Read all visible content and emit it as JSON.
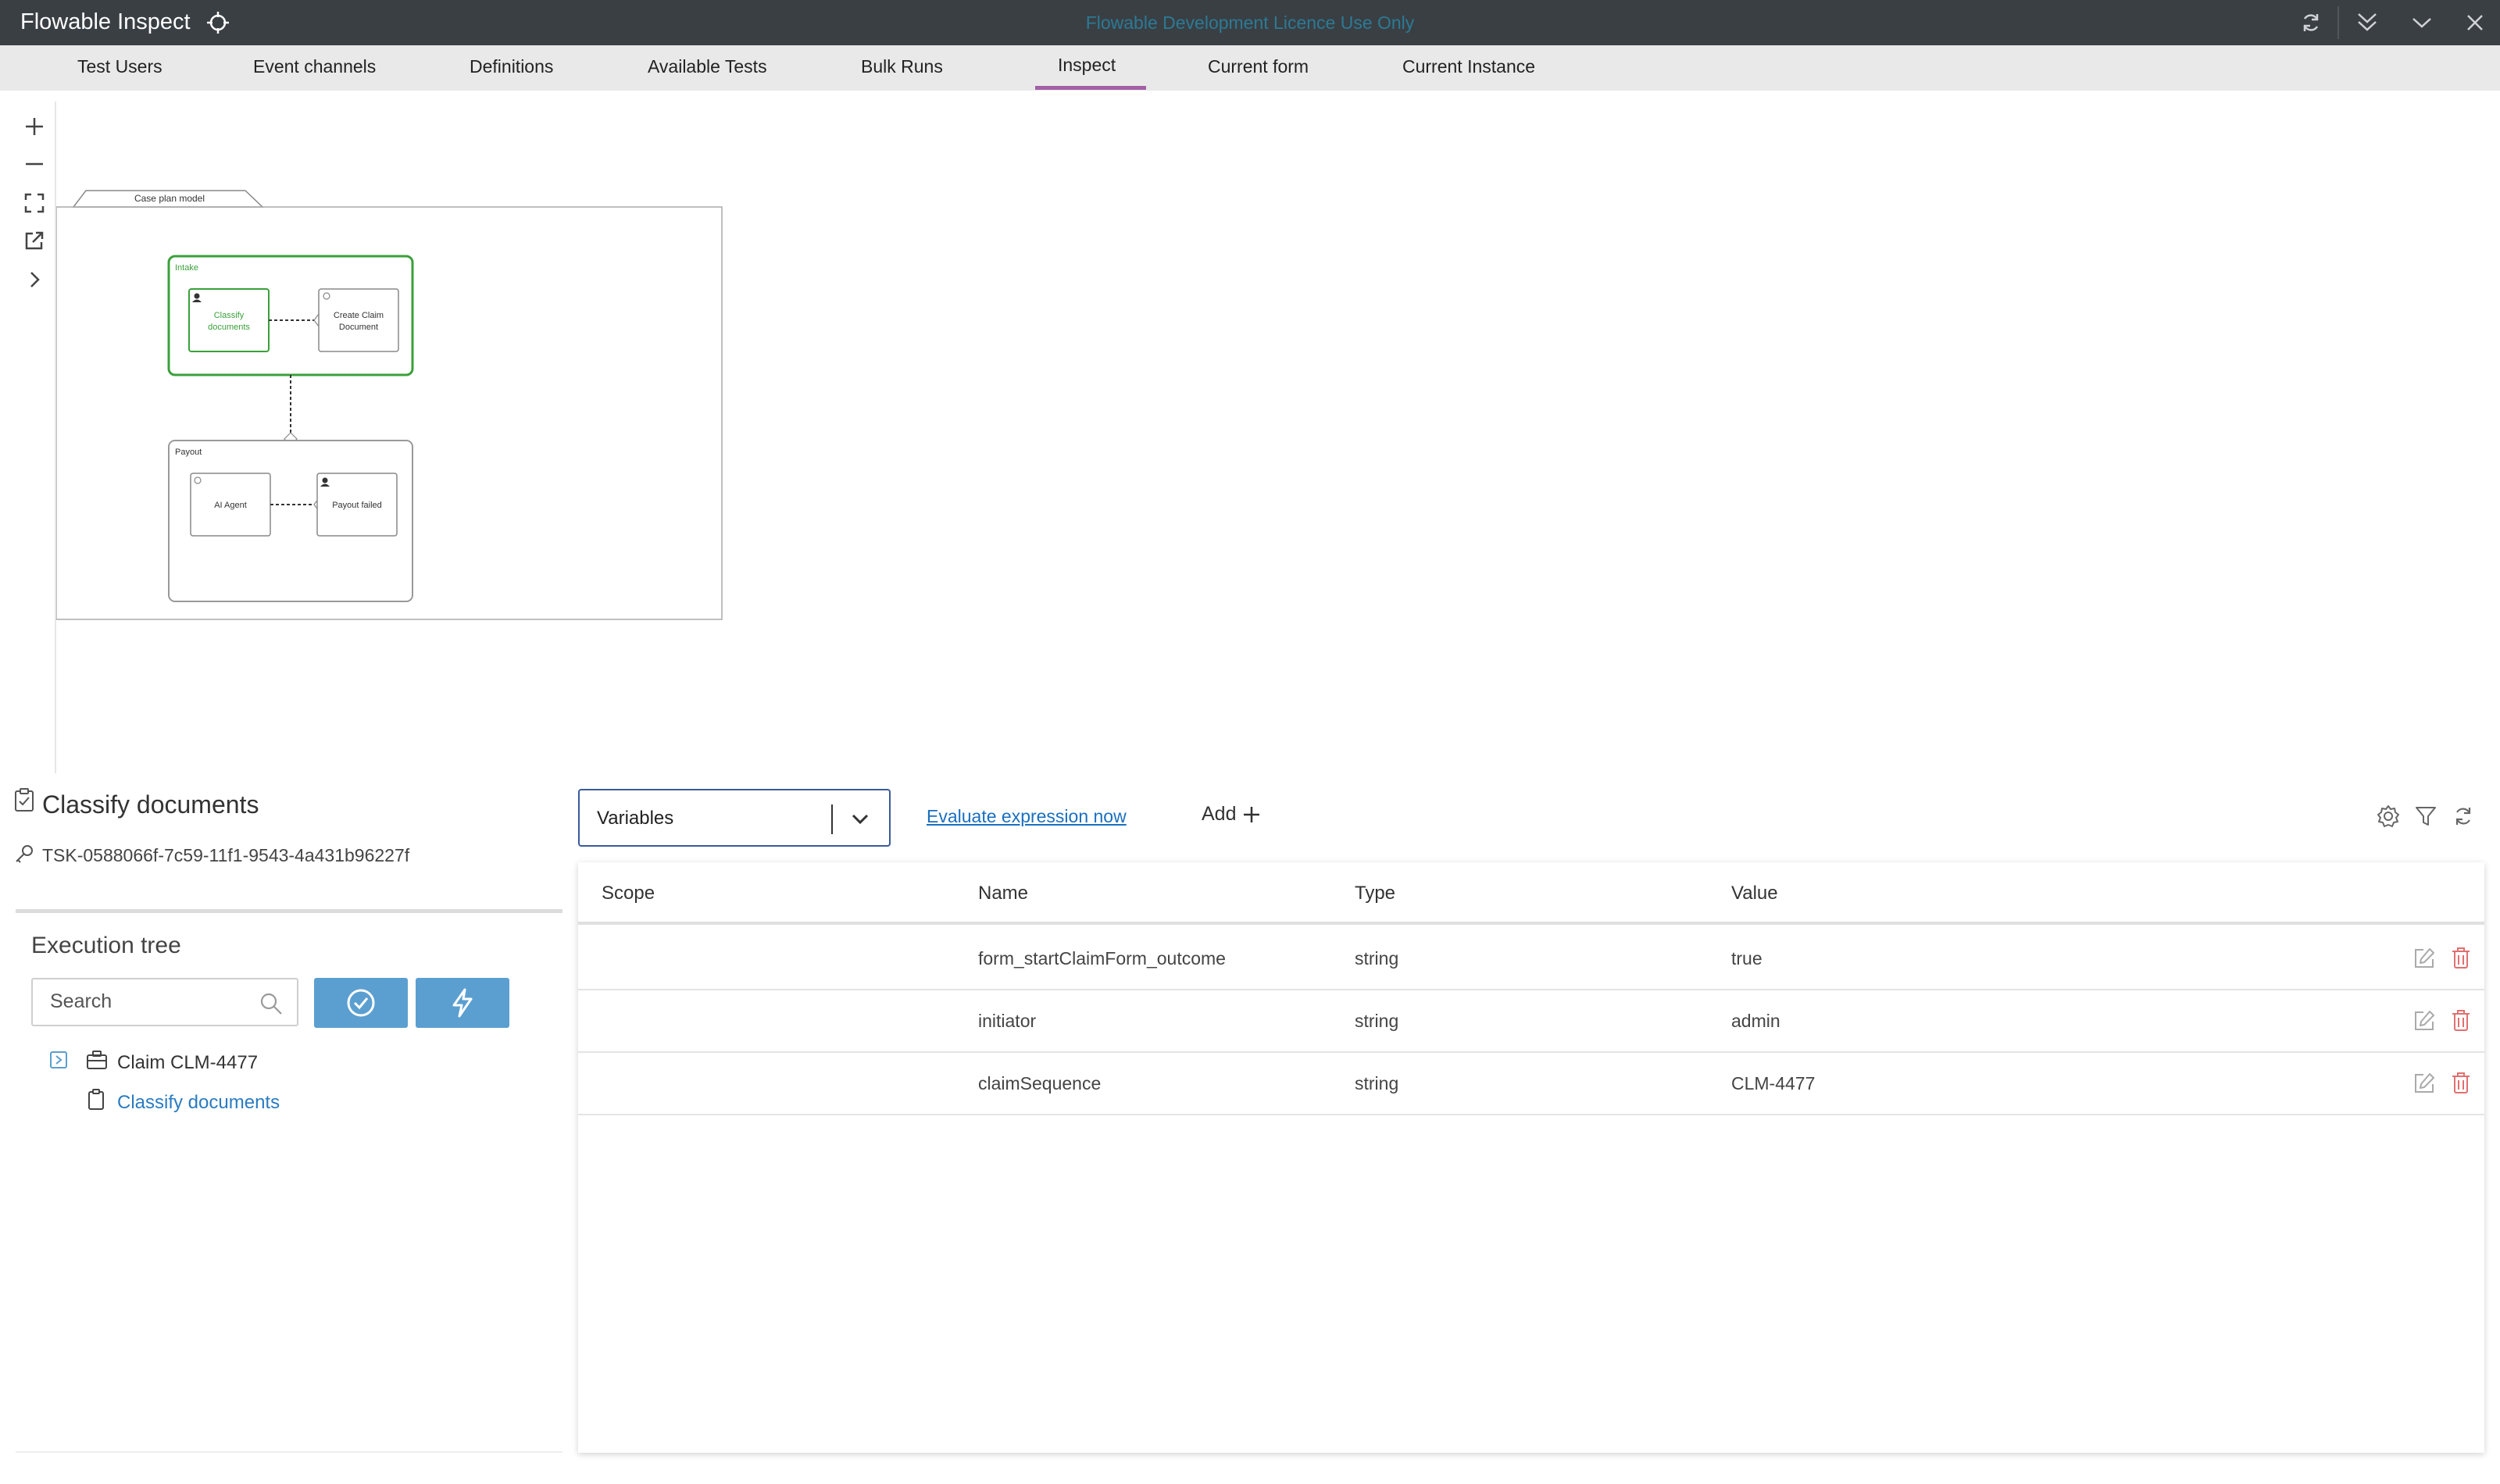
{
  "app": {
    "title": "Flowable Inspect",
    "licence_banner": "Flowable Development Licence Use Only"
  },
  "nav": {
    "tabs": [
      {
        "label": "Test Users"
      },
      {
        "label": "Event channels"
      },
      {
        "label": "Definitions"
      },
      {
        "label": "Available Tests"
      },
      {
        "label": "Bulk Runs"
      },
      {
        "label": "Inspect"
      },
      {
        "label": "Current form"
      },
      {
        "label": "Current Instance"
      }
    ],
    "active_tab": "Inspect",
    "active_color": "#a35fa8"
  },
  "diagram": {
    "case_plan_label": "Case plan model",
    "stages": [
      {
        "label": "Intake",
        "color": "#3aa03a",
        "active": true
      },
      {
        "label": "Payout",
        "color": "#999999",
        "active": false
      }
    ],
    "tasks": [
      {
        "label_line1": "Classify",
        "label_line2": "documents",
        "active": true
      },
      {
        "label_line1": "Create Claim",
        "label_line2": "Document",
        "active": false
      },
      {
        "label_line1": "AI Agent",
        "label_line2": "",
        "active": false
      },
      {
        "label_line1": "Payout failed",
        "label_line2": "",
        "active": false
      }
    ]
  },
  "task": {
    "title": "Classify documents",
    "id": "TSK-0588066f-7c59-11f1-9543-4a431b96227f"
  },
  "execution_tree": {
    "title": "Execution tree",
    "search_placeholder": "Search",
    "nodes": [
      {
        "label": "Claim CLM-4477",
        "type": "case"
      },
      {
        "label": "Classify documents",
        "type": "task"
      }
    ]
  },
  "variables_panel": {
    "select_value": "Variables",
    "evaluate_link": "Evaluate expression now",
    "add_label": "Add",
    "columns": {
      "scope": "Scope",
      "name": "Name",
      "type": "Type",
      "value": "Value"
    },
    "rows": [
      {
        "scope": "",
        "name": "form_startClaimForm_outcome",
        "type": "string",
        "value": "true"
      },
      {
        "scope": "",
        "name": "initiator",
        "type": "string",
        "value": "admin"
      },
      {
        "scope": "",
        "name": "claimSequence",
        "type": "string",
        "value": "CLM-4477"
      }
    ]
  },
  "colors": {
    "titlebar": "#3a3f44",
    "primary_button": "#5b9fd0",
    "link": "#1a6fc0",
    "delete": "#e07070",
    "active_stage": "#3aa03a"
  }
}
